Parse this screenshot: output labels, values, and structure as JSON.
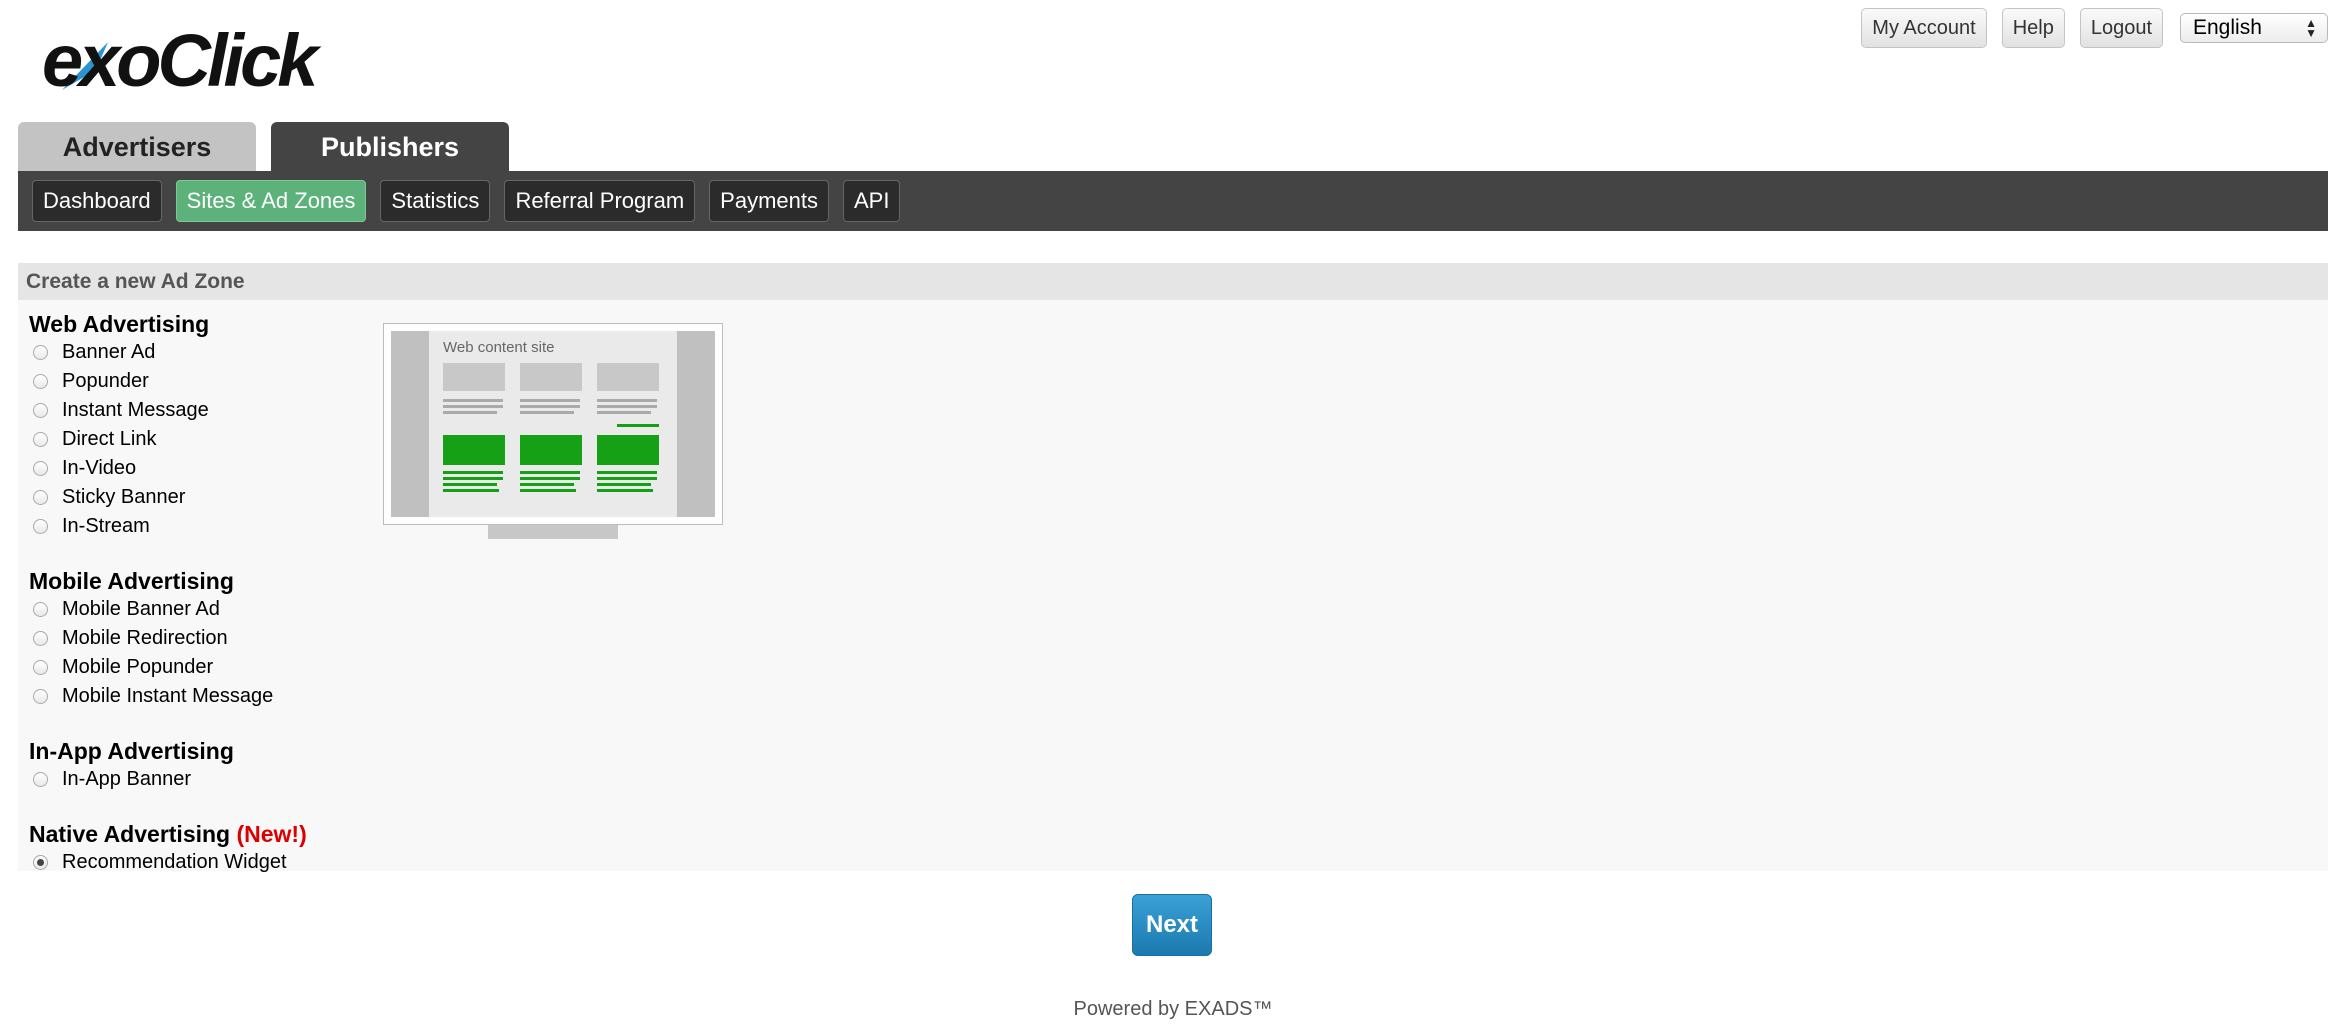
{
  "logo": {
    "text": "exoClick"
  },
  "top_links": {
    "my_account": "My Account",
    "help": "Help",
    "logout": "Logout"
  },
  "language": {
    "selected": "English"
  },
  "main_tabs": [
    {
      "label": "Advertisers"
    },
    {
      "label": "Publishers"
    }
  ],
  "sub_nav": [
    {
      "label": "Dashboard"
    },
    {
      "label": "Sites & Ad Zones"
    },
    {
      "label": "Statistics"
    },
    {
      "label": "Referral Program"
    },
    {
      "label": "Payments"
    },
    {
      "label": "API"
    }
  ],
  "panel": {
    "title": "Create a new Ad Zone",
    "web": {
      "title": "Web Advertising",
      "options": [
        "Banner Ad",
        "Popunder",
        "Instant Message",
        "Direct Link",
        "In-Video",
        "Sticky Banner",
        "In-Stream"
      ]
    },
    "mobile": {
      "title": "Mobile Advertising",
      "options": [
        "Mobile Banner Ad",
        "Mobile Redirection",
        "Mobile Popunder",
        "Mobile Instant Message"
      ]
    },
    "inapp": {
      "title": "In-App Advertising",
      "options": [
        "In-App Banner"
      ]
    },
    "native": {
      "title": "Native Advertising",
      "new_flag": "(New!)",
      "options": [
        "Recommendation Widget"
      ],
      "selected": "Recommendation Widget"
    }
  },
  "preview": {
    "site_label": "Web content site"
  },
  "next_label": "Next",
  "footer": "Powered by EXADS™",
  "colors": {
    "active_subnav": "#5cb27a",
    "nav_bg": "#444444",
    "next_button": "#2a8cc3",
    "new_flag": "#dd0000"
  }
}
